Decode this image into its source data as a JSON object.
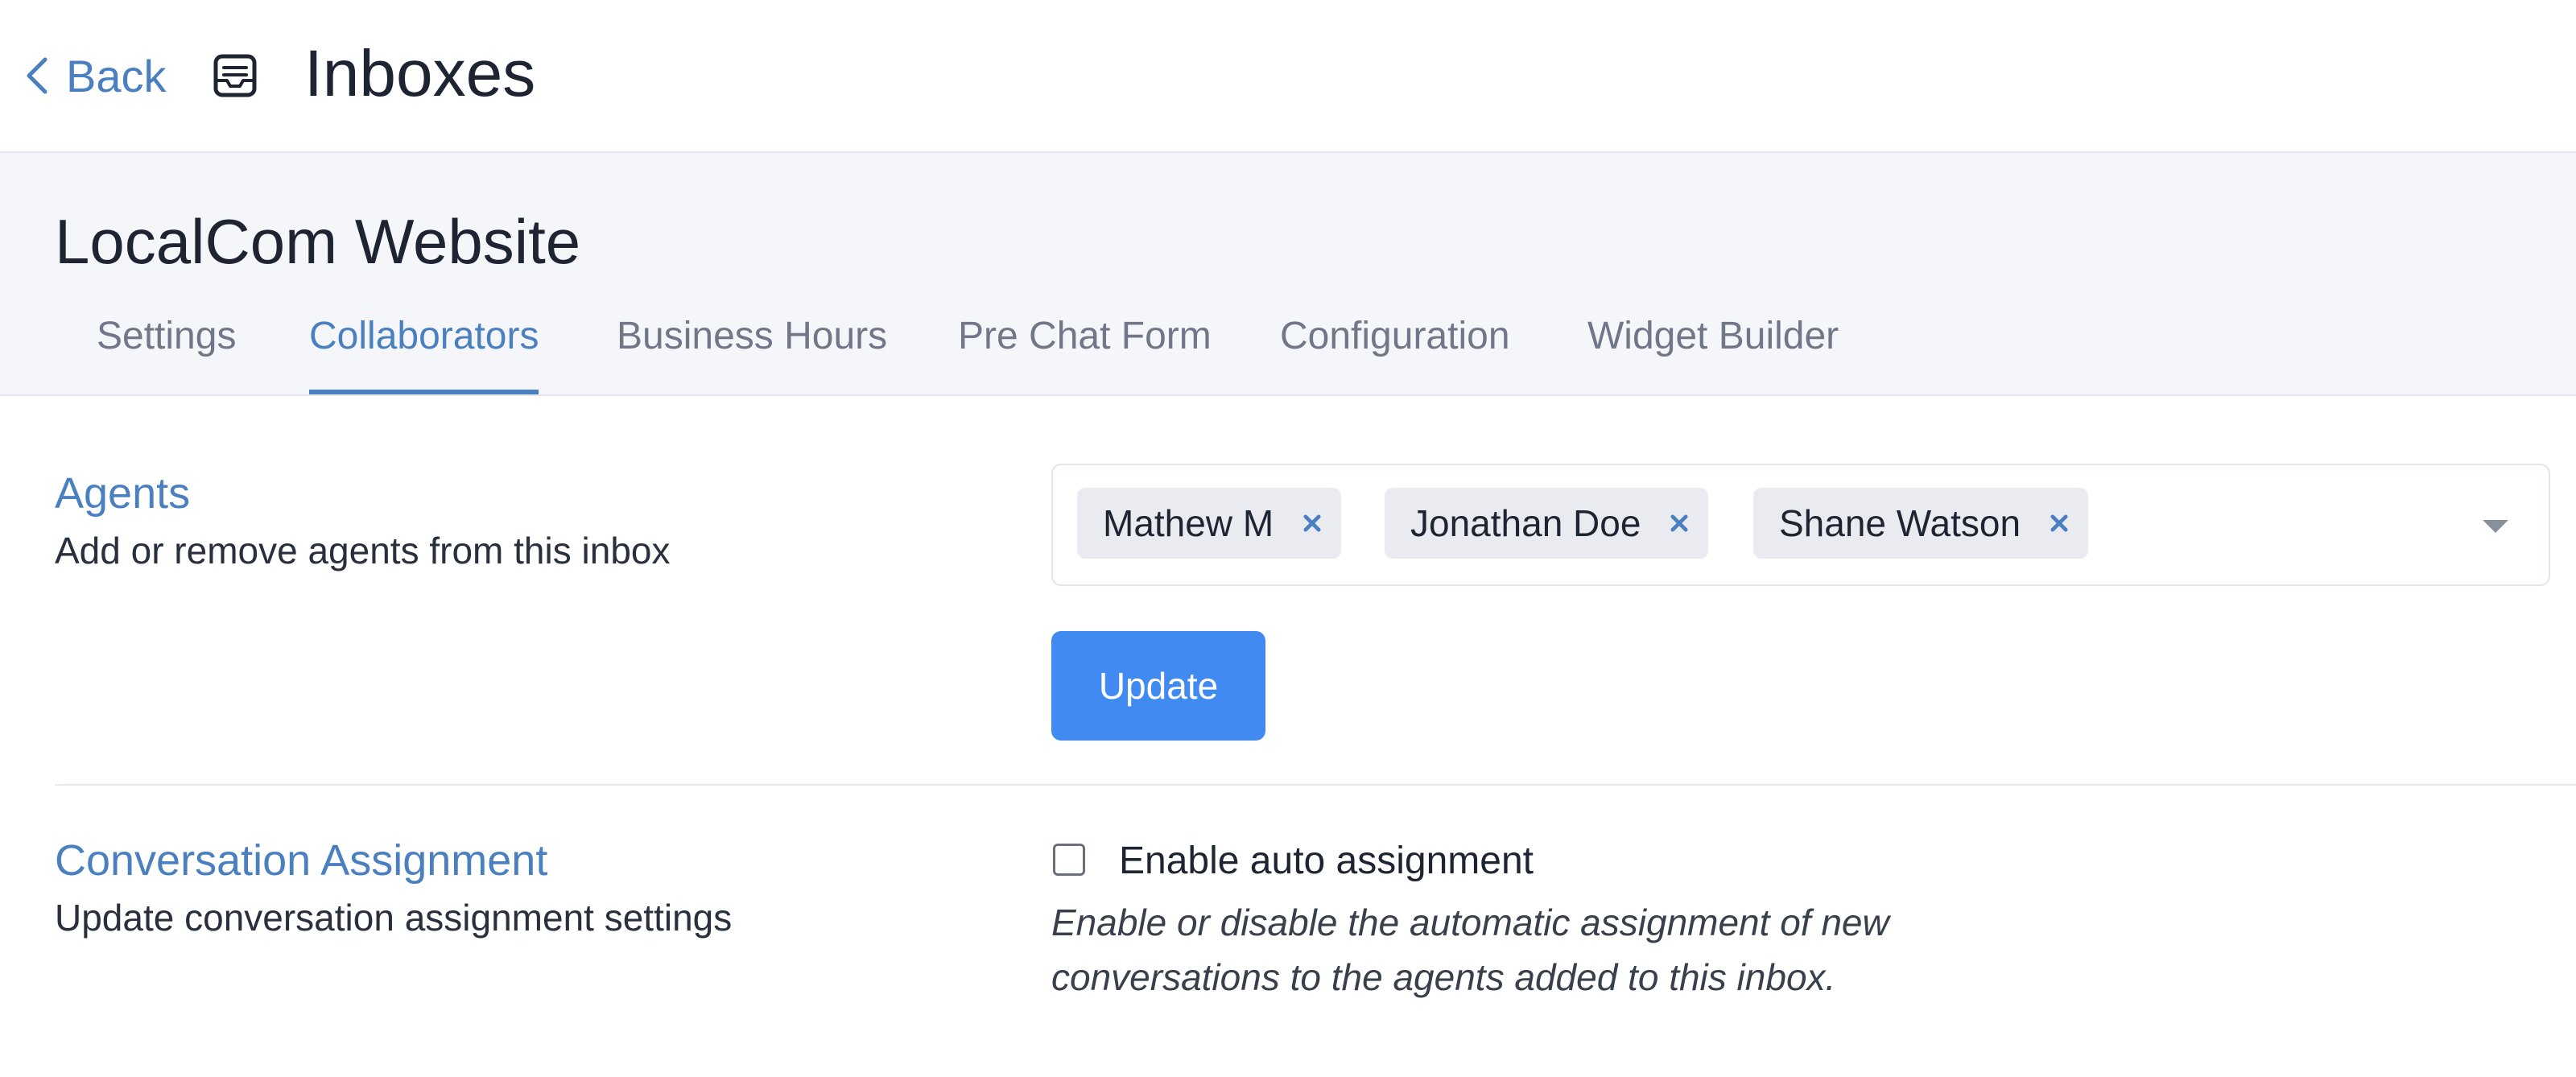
{
  "header": {
    "back_label": "Back",
    "title": "Inboxes",
    "icon": "inbox-icon"
  },
  "inbox": {
    "name": "LocalCom Website"
  },
  "tabs": [
    {
      "label": "Settings",
      "active": false
    },
    {
      "label": "Collaborators",
      "active": true
    },
    {
      "label": "Business Hours",
      "active": false
    },
    {
      "label": "Pre Chat Form",
      "active": false
    },
    {
      "label": "Configuration",
      "active": false
    },
    {
      "label": "Widget Builder",
      "active": false
    }
  ],
  "agents": {
    "title": "Agents",
    "description": "Add or remove agents from this inbox",
    "selected": [
      "Mathew M",
      "Jonathan Doe",
      "Shane Watson"
    ],
    "update_label": "Update"
  },
  "assignment": {
    "title": "Conversation Assignment",
    "description": "Update conversation assignment settings",
    "checkbox_label": "Enable auto assignment",
    "checked": false,
    "help_line1": "Enable or disable the automatic assignment of new",
    "help_line2": "conversations to the agents added to this inbox."
  },
  "colors": {
    "accent": "#4a7fc0",
    "primary_button": "#418af2",
    "subheader_bg": "#f5f6fa",
    "chip_bg": "#e9ebf0"
  }
}
